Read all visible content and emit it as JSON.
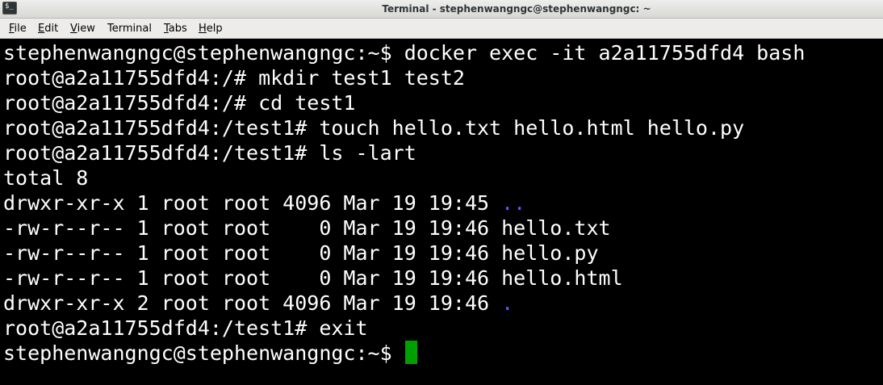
{
  "window": {
    "title": "Terminal - stephenwangngc@stephenwangngc: ~",
    "icon": "terminal-app-icon",
    "icon_glyph": "$_"
  },
  "menubar": {
    "items": [
      {
        "mnemonic": "F",
        "rest": "ile"
      },
      {
        "mnemonic": "E",
        "rest": "dit"
      },
      {
        "mnemonic": "V",
        "rest": "iew"
      },
      {
        "mnemonic": "",
        "rest": "Terminal"
      },
      {
        "mnemonic": "T",
        "rest": "abs"
      },
      {
        "mnemonic": "H",
        "rest": "elp"
      }
    ]
  },
  "terminal": {
    "colors": {
      "background": "#000000",
      "foreground": "#ffffff",
      "directory": "#5c5cff",
      "cursor": "#00a000"
    },
    "lines": [
      {
        "text": "stephenwangngc@stephenwangngc:~$ docker exec -it a2a11755dfd4 bash",
        "dir": ""
      },
      {
        "text": "root@a2a11755dfd4:/# mkdir test1 test2",
        "dir": ""
      },
      {
        "text": "root@a2a11755dfd4:/# cd test1",
        "dir": ""
      },
      {
        "text": "root@a2a11755dfd4:/test1# touch hello.txt hello.html hello.py",
        "dir": ""
      },
      {
        "text": "root@a2a11755dfd4:/test1# ls -lart",
        "dir": ""
      },
      {
        "text": "total 8",
        "dir": ""
      },
      {
        "text": "drwxr-xr-x 1 root root 4096 Mar 19 19:45 ",
        "dir": ".."
      },
      {
        "text": "-rw-r--r-- 1 root root    0 Mar 19 19:46 hello.txt",
        "dir": ""
      },
      {
        "text": "-rw-r--r-- 1 root root    0 Mar 19 19:46 hello.py",
        "dir": ""
      },
      {
        "text": "-rw-r--r-- 1 root root    0 Mar 19 19:46 hello.html",
        "dir": ""
      },
      {
        "text": "drwxr-xr-x 2 root root 4096 Mar 19 19:46 ",
        "dir": "."
      },
      {
        "text": "root@a2a11755dfd4:/test1# exit",
        "dir": ""
      },
      {
        "text": "stephenwangngc@stephenwangngc:~$ ",
        "dir": ""
      }
    ]
  }
}
